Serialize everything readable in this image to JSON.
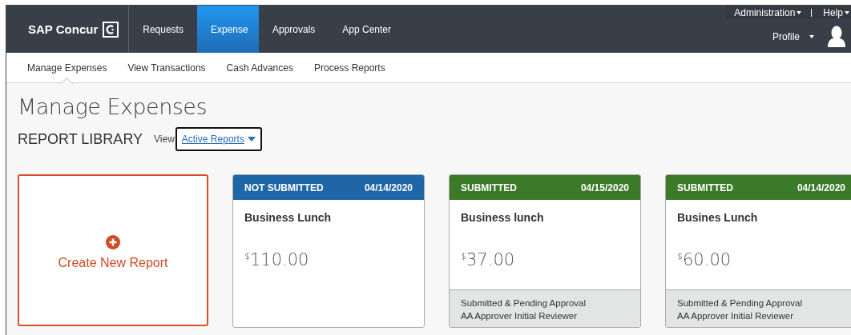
{
  "header": {
    "logo": "SAP Concur",
    "tabs": [
      {
        "label": "Requests",
        "selected": false
      },
      {
        "label": "Expense",
        "selected": true
      },
      {
        "label": "Approvals",
        "selected": false
      },
      {
        "label": "App Center",
        "selected": false
      }
    ],
    "utility_links": [
      "Administration",
      "Help"
    ],
    "profile": "Profile"
  },
  "subnav": [
    {
      "label": "Manage Expenses",
      "selected": true
    },
    {
      "label": "View Transactions",
      "selected": false
    },
    {
      "label": "Cash Advances",
      "selected": false
    },
    {
      "label": "Process Reports",
      "selected": false
    }
  ],
  "page_title": "Manage Expenses",
  "section_title": "REPORT LIBRARY",
  "view_label": "View",
  "view_value": "Active Reports",
  "create_card": "Create New Report",
  "reports": [
    {
      "kind": "not_submitted",
      "status": "NOT SUBMITTED",
      "date": "04/14/2020",
      "name": "Business Lunch",
      "currency": "$",
      "amount": "110.00"
    },
    {
      "kind": "submitted",
      "status": "SUBMITTED",
      "date": "04/15/2020",
      "name": "Business lunch",
      "currency": "$",
      "amount": "37.00",
      "footer": [
        "Submitted & Pending Approval",
        "AA Approver Initial Reviewer"
      ]
    },
    {
      "kind": "submitted",
      "status": "SUBMITTED",
      "date": "04/14/2020",
      "name": "Busines Lunch",
      "currency": "$",
      "amount": "60.00",
      "footer": [
        "Submitted & Pending Approval",
        "AA Approver Initial Reviewer"
      ]
    }
  ]
}
